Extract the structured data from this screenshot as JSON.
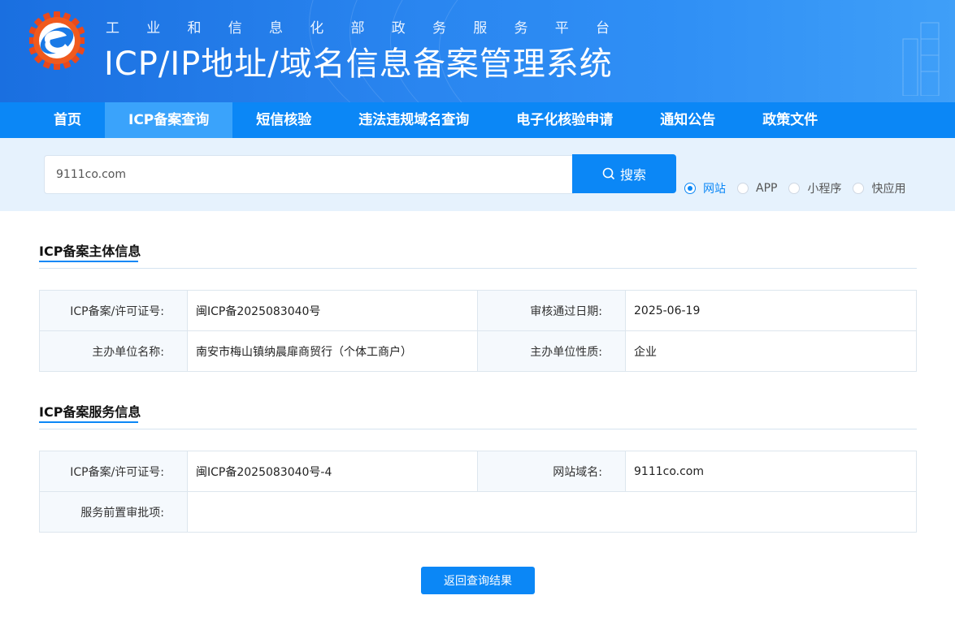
{
  "header": {
    "subtitle": [
      "工",
      "业",
      "和",
      "信",
      "息",
      "化",
      "部",
      "政",
      "务",
      "服",
      "务",
      "平",
      "台"
    ],
    "title": "ICP/IP地址/域名信息备案管理系统"
  },
  "nav": {
    "items": [
      {
        "label": "首页",
        "active": false
      },
      {
        "label": "ICP备案查询",
        "active": true
      },
      {
        "label": "短信核验",
        "active": false
      },
      {
        "label": "违法违规域名查询",
        "active": false
      },
      {
        "label": "电子化核验申请",
        "active": false
      },
      {
        "label": "通知公告",
        "active": false
      },
      {
        "label": "政策文件",
        "active": false
      }
    ]
  },
  "search": {
    "value": "9111co.com",
    "button_label": "搜索",
    "button_icon": "search-icon",
    "types": [
      {
        "label": "网站",
        "checked": true
      },
      {
        "label": "APP",
        "checked": false
      },
      {
        "label": "小程序",
        "checked": false
      },
      {
        "label": "快应用",
        "checked": false
      }
    ]
  },
  "subject_section": {
    "title": "ICP备案主体信息",
    "rows": [
      {
        "label1": "ICP备案/许可证号:",
        "value1": "闽ICP备2025083040号",
        "label2": "审核通过日期:",
        "value2": "2025-06-19"
      },
      {
        "label1": "主办单位名称:",
        "value1": "南安市梅山镇纳晨扉商贸行（个体工商户）",
        "label2": "主办单位性质:",
        "value2": "企业"
      }
    ]
  },
  "service_section": {
    "title": "ICP备案服务信息",
    "row1": {
      "label1": "ICP备案/许可证号:",
      "value1": "闽ICP备2025083040号-4",
      "label2": "网站域名:",
      "value2": "9111co.com"
    },
    "row2": {
      "label": "服务前置审批项:",
      "value": ""
    }
  },
  "back_button": "返回查询结果",
  "colors": {
    "primary": "#0b87f6",
    "nav_active": "#3aa3fb",
    "search_bg": "#e6f2fd"
  }
}
